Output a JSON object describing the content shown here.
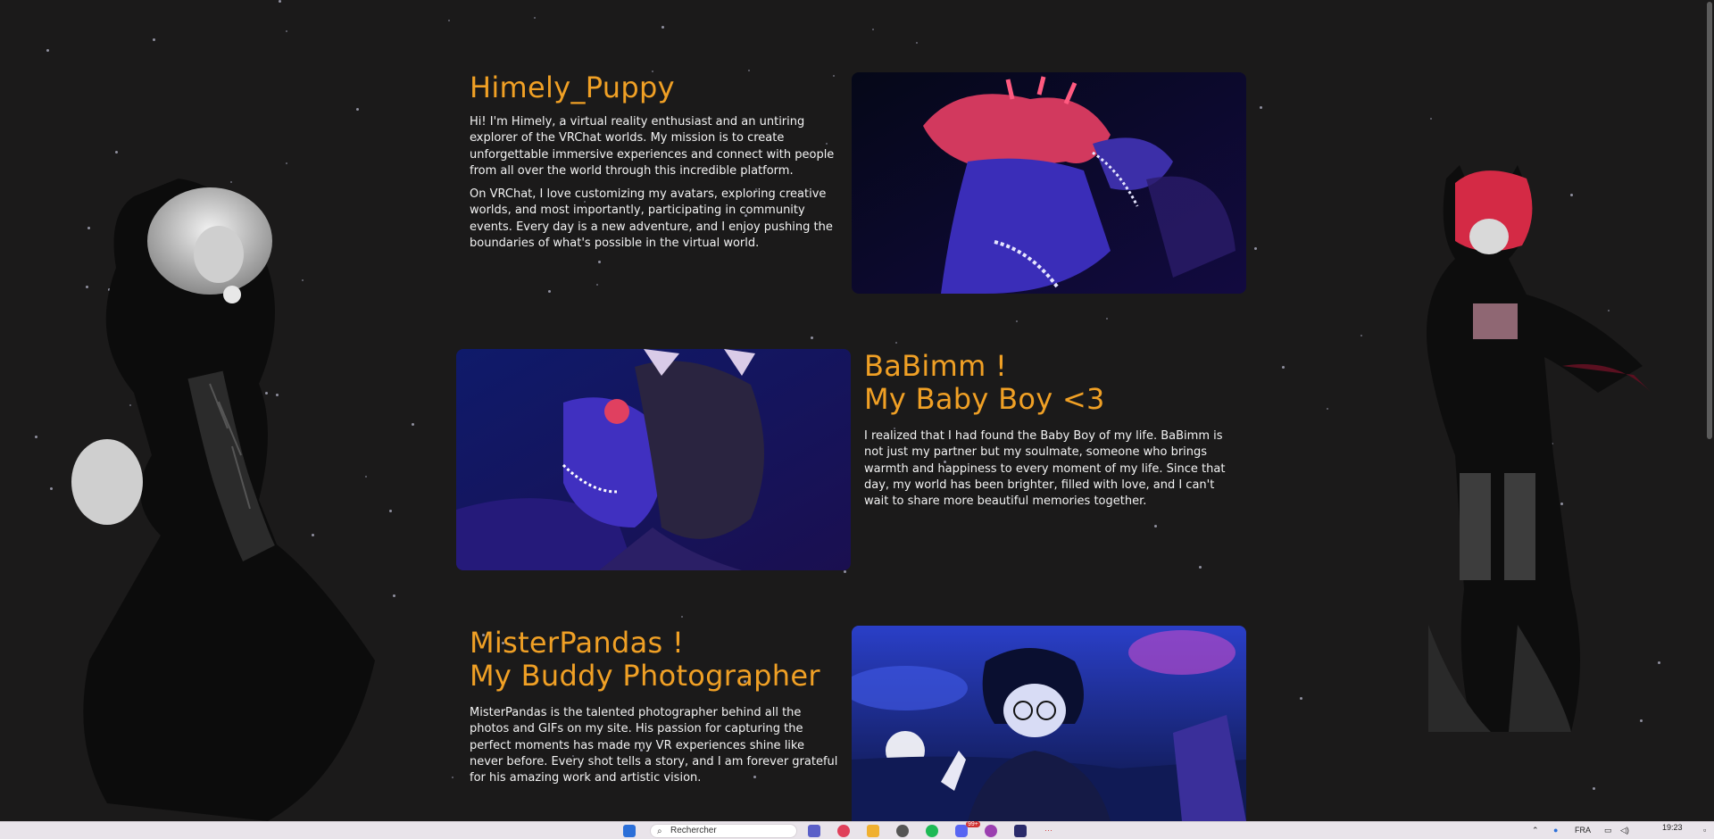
{
  "profile": {
    "name": "Himely_Puppy",
    "intro": "Hi! I'm Himely, a virtual reality enthusiast and an untiring explorer of the VRChat worlds. My mission is to create unforgettable immersive experiences and connect with people from all over the world through this incredible platform.",
    "details": "On VRChat, I love customizing my avatars, exploring creative worlds, and most importantly, participating in community events. Every day is a new adventure, and I enjoy pushing the boundaries of what's possible in the virtual world."
  },
  "partner": {
    "title_line1": "BaBimm !",
    "title_line2": "My Baby Boy <3",
    "text": "I realized that I had found the Baby Boy of my life. BaBimm is not just my partner but my soulmate, someone who brings warmth and happiness to every moment of my life. Since that day, my world has been brighter, filled with love, and I can't wait to share more beautiful memories together."
  },
  "photographer": {
    "title_line1": "MisterPandas !",
    "title_line2": "My Buddy Photographer",
    "text": "MisterPandas is the talented photographer behind all the photos and GIFs on my site. His passion for capturing the perfect moments has made my VR experiences shine like never before. Every shot tells a story, and I am forever grateful for his amazing work and artistic vision."
  },
  "taskbar": {
    "search_placeholder": "Rechercher",
    "language": "FRA",
    "time": "19:23",
    "notification_badge": "99+"
  },
  "colors": {
    "background": "#1b1a1a",
    "accent": "#f0a025",
    "text": "#f3f3f3"
  }
}
